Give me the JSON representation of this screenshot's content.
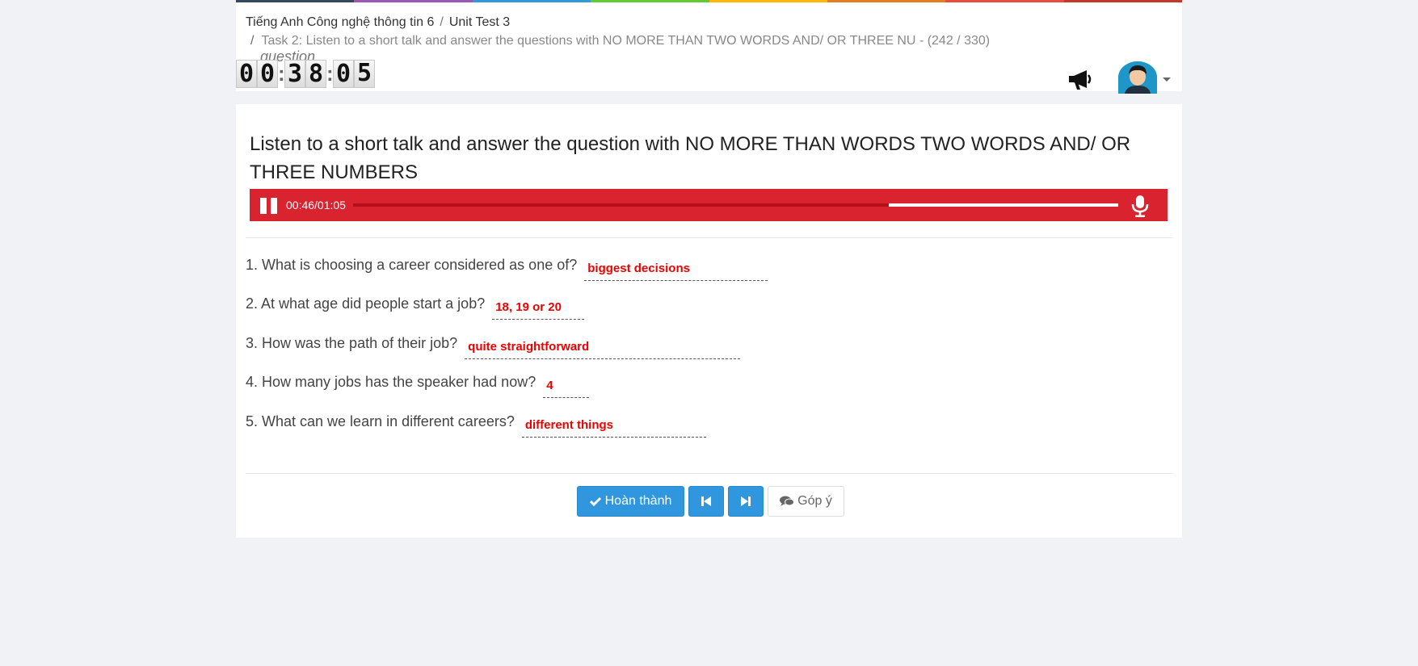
{
  "colors": {
    "topbar": [
      "#34495e",
      "#9b59b6",
      "#3498db",
      "#62cb31",
      "#ffb606",
      "#e67e22",
      "#e74c3c",
      "#c0392b"
    ],
    "player_bg": "#d9232e",
    "answer_text": "#e00000",
    "primary_button": "#3097de",
    "page_bg": "#f0f2f5"
  },
  "breadcrumb": {
    "course": "Tiếng Anh Công nghệ thông tin 6",
    "sep1": "/",
    "unit": "Unit Test 3",
    "sep2": "/",
    "task": "Task 2: Listen to a short talk and answer the questions with NO MORE THAN TWO WORDS AND/ OR THREE NU - ",
    "question_word": "question",
    "progress": " (242 / 330)"
  },
  "timer": {
    "h1": "0",
    "h2": "0",
    "colon1": ":",
    "m1": "3",
    "m2": "8",
    "colon2": ":",
    "s1": "0",
    "s2": "5"
  },
  "header_icons": {
    "announce": "megaphone-icon",
    "user": "avatar",
    "menu": "caret-down-icon"
  },
  "question_title": "Listen to a short talk and answer the question with NO MORE THAN WORDS TWO WORDS AND/ OR THREE NUMBERS",
  "player": {
    "time": "00:46/01:05",
    "progress_fraction": 0.7,
    "play_icon": "pause-icon",
    "mic_icon": "microphone-icon"
  },
  "questions": [
    {
      "text": "1. What is choosing a career considered as one of?",
      "answer": "biggest decisions"
    },
    {
      "text": "2. At what age did people start a job?",
      "answer": "18, 19 or 20"
    },
    {
      "text": "3. How was the path of their job?",
      "answer": "quite straightforward"
    },
    {
      "text": "4. How many jobs has the speaker had now?",
      "answer": "4"
    },
    {
      "text": "5. What can we learn in different careers?",
      "answer": "different things"
    }
  ],
  "buttons": {
    "finish": "Hoàn thành",
    "finish_icon": "check-icon",
    "prev_icon": "step-backward-icon",
    "next_icon": "step-forward-icon",
    "feedback": "Góp ý",
    "feedback_icon": "comments-icon"
  }
}
